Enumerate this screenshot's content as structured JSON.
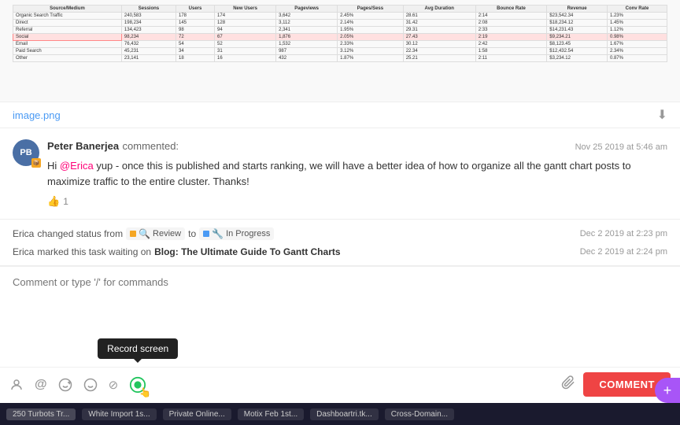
{
  "image": {
    "filename": "image.png",
    "download_label": "⬇"
  },
  "comment": {
    "author": "Peter Banerjea",
    "action": "commented:",
    "timestamp": "Nov 25 2019 at 5:46 am",
    "avatar_initials": "PB",
    "avatar_badge": "📦",
    "text_part1": "Hi ",
    "mention": "@Erica",
    "text_part2": " yup - once this is published and starts ranking, we will have a better idea of how to organize all the gantt chart posts to maximize traffic to the entire cluster. Thanks!",
    "like_count": "1"
  },
  "activity": [
    {
      "actor": "Erica",
      "action": "changed status from",
      "from_status": "Review",
      "to_label": "to",
      "to_status": "In Progress",
      "timestamp": "Dec 2 2019 at 2:23 pm"
    },
    {
      "actor": "Erica",
      "action": "marked this task waiting on",
      "task_link": "Blog: The Ultimate Guide To Gantt Charts",
      "timestamp": "Dec 2 2019 at 2:24 pm"
    }
  ],
  "comment_input": {
    "placeholder": "Comment or type '/' for commands"
  },
  "toolbar": {
    "icons": [
      {
        "name": "user-icon",
        "symbol": "👤"
      },
      {
        "name": "at-mention-icon",
        "symbol": "@"
      },
      {
        "name": "smile-plus-icon",
        "symbol": "🙂"
      },
      {
        "name": "emoji-icon",
        "symbol": "😊"
      },
      {
        "name": "slash-command-icon",
        "symbol": "/"
      },
      {
        "name": "record-screen-icon",
        "symbol": "⏺"
      }
    ],
    "attach_icon": "📎",
    "comment_button": "COMMENT"
  },
  "tooltip": {
    "text": "Record screen"
  },
  "table_rows": [
    [
      "Organic Search Traffic",
      "240,583",
      "178",
      "174",
      "3,642",
      "2.45%",
      "28.61",
      "2:14",
      "$23,542.34",
      "1.23%"
    ],
    [
      "Direct",
      "198,234",
      "145",
      "128",
      "3,112",
      "2.14%",
      "31.42",
      "2:08",
      "$18,234.12",
      "1.45%"
    ],
    [
      "Referral",
      "134,423",
      "98",
      "94",
      "2,341",
      "1.95%",
      "29.31",
      "2:33",
      "$14,231.43",
      "1.12%"
    ],
    [
      "Social",
      "98,234",
      "72",
      "67",
      "1,876",
      "2.05%",
      "27.43",
      "2:19",
      "$9,234.21",
      "0.98%"
    ],
    [
      "Email",
      "76,432",
      "54",
      "52",
      "1,532",
      "2.33%",
      "30.12",
      "2:42",
      "$8,123.45",
      "1.67%"
    ],
    [
      "Paid Search",
      "45,231",
      "34",
      "31",
      "987",
      "3.12%",
      "22.34",
      "1:58",
      "$12,432.54",
      "2.34%"
    ],
    [
      "Other",
      "23,141",
      "18",
      "16",
      "432",
      "1.87%",
      "25.21",
      "2:11",
      "$3,234.12",
      "0.87%"
    ]
  ],
  "table_headers": [
    "Source/Medium",
    "Sessions",
    "Users",
    "New Users",
    "Pageviews",
    "Pages/Sess",
    "Avg Duration",
    "Bounce Rate",
    "Revenue",
    "Conv Rate"
  ],
  "bottom_taskbar": {
    "items": [
      "250 Turbots Tr...",
      "White Import 1s...",
      "Private Online...",
      "Motix Feb 1st...",
      "Dashboartri.tk...",
      "Cross-Domain..."
    ]
  },
  "fab": {
    "symbol": "+"
  }
}
